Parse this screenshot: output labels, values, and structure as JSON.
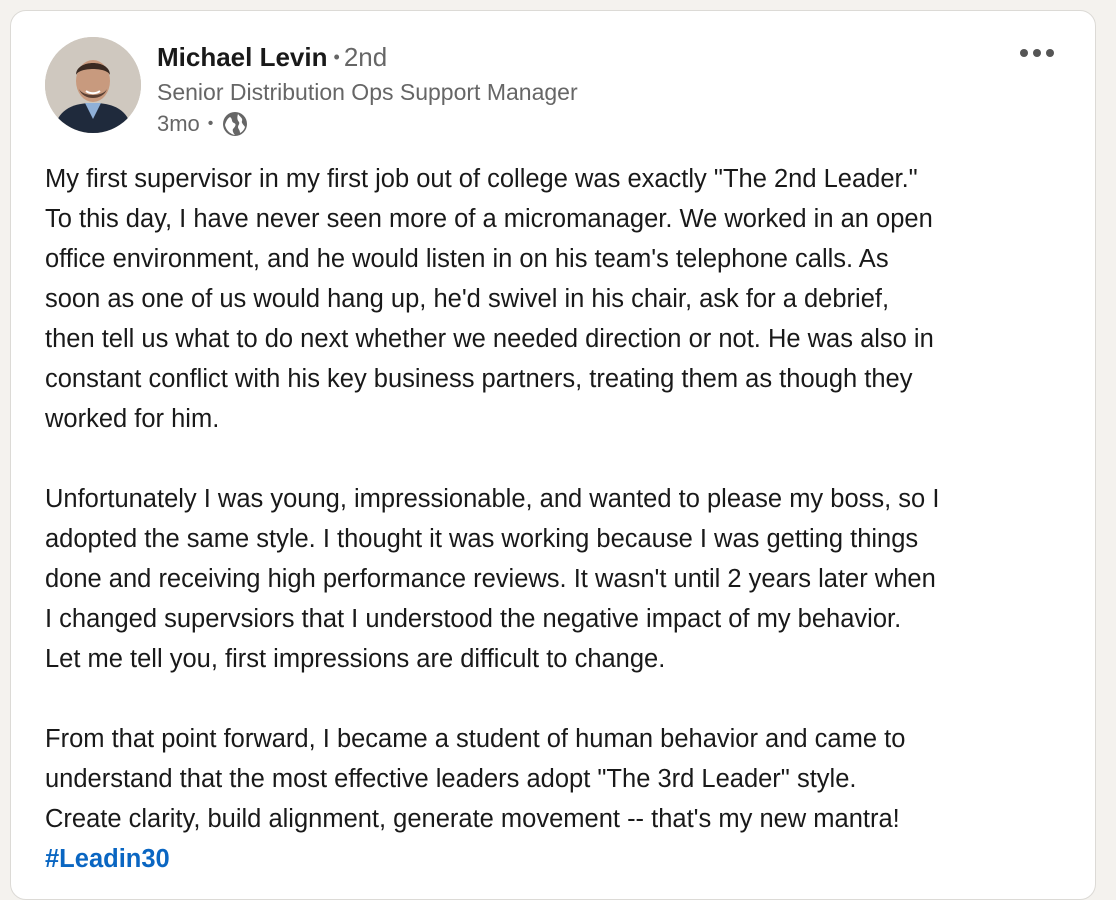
{
  "author": {
    "name": "Michael Levin",
    "degree": "2nd",
    "headline": "Senior Distribution Ops Support Manager",
    "time": "3mo",
    "visibility_icon": "globe-icon"
  },
  "menu_icon": "more-horizontal-icon",
  "post": {
    "paragraph_1": [
      "My first supervisor in my first job out of college was exactly \"The 2nd Leader.\"",
      "To this day, I have never seen more of a micromanager. We worked in an open",
      "office environment, and he would listen in on his team's telephone calls. As",
      "soon as one of us would hang up, he'd swivel in his chair, ask for a debrief,",
      "then tell us what to do next whether we needed direction or not. He was also in",
      "constant conflict with his key business partners, treating them as though they",
      "worked for him."
    ],
    "paragraph_2": [
      "Unfortunately I was young, impressionable, and wanted to please my boss, so I",
      "adopted the same style. I thought it was working because I was getting things",
      "done and receiving high performance reviews. It wasn't until 2 years later when",
      "I changed supervsiors that I understood the negative impact of my behavior.",
      "Let me tell you, first impressions are difficult to change."
    ],
    "paragraph_3": [
      "From that point forward, I became a student of human behavior and came to",
      "understand that the most effective leaders adopt \"The 3rd Leader\" style.",
      "Create clarity, build alignment, generate movement -- that's my new mantra!"
    ],
    "hashtag": "#Leadin30"
  },
  "colors": {
    "link": "#0a66c2",
    "secondary_text": "#666666",
    "card_bg": "#ffffff"
  }
}
